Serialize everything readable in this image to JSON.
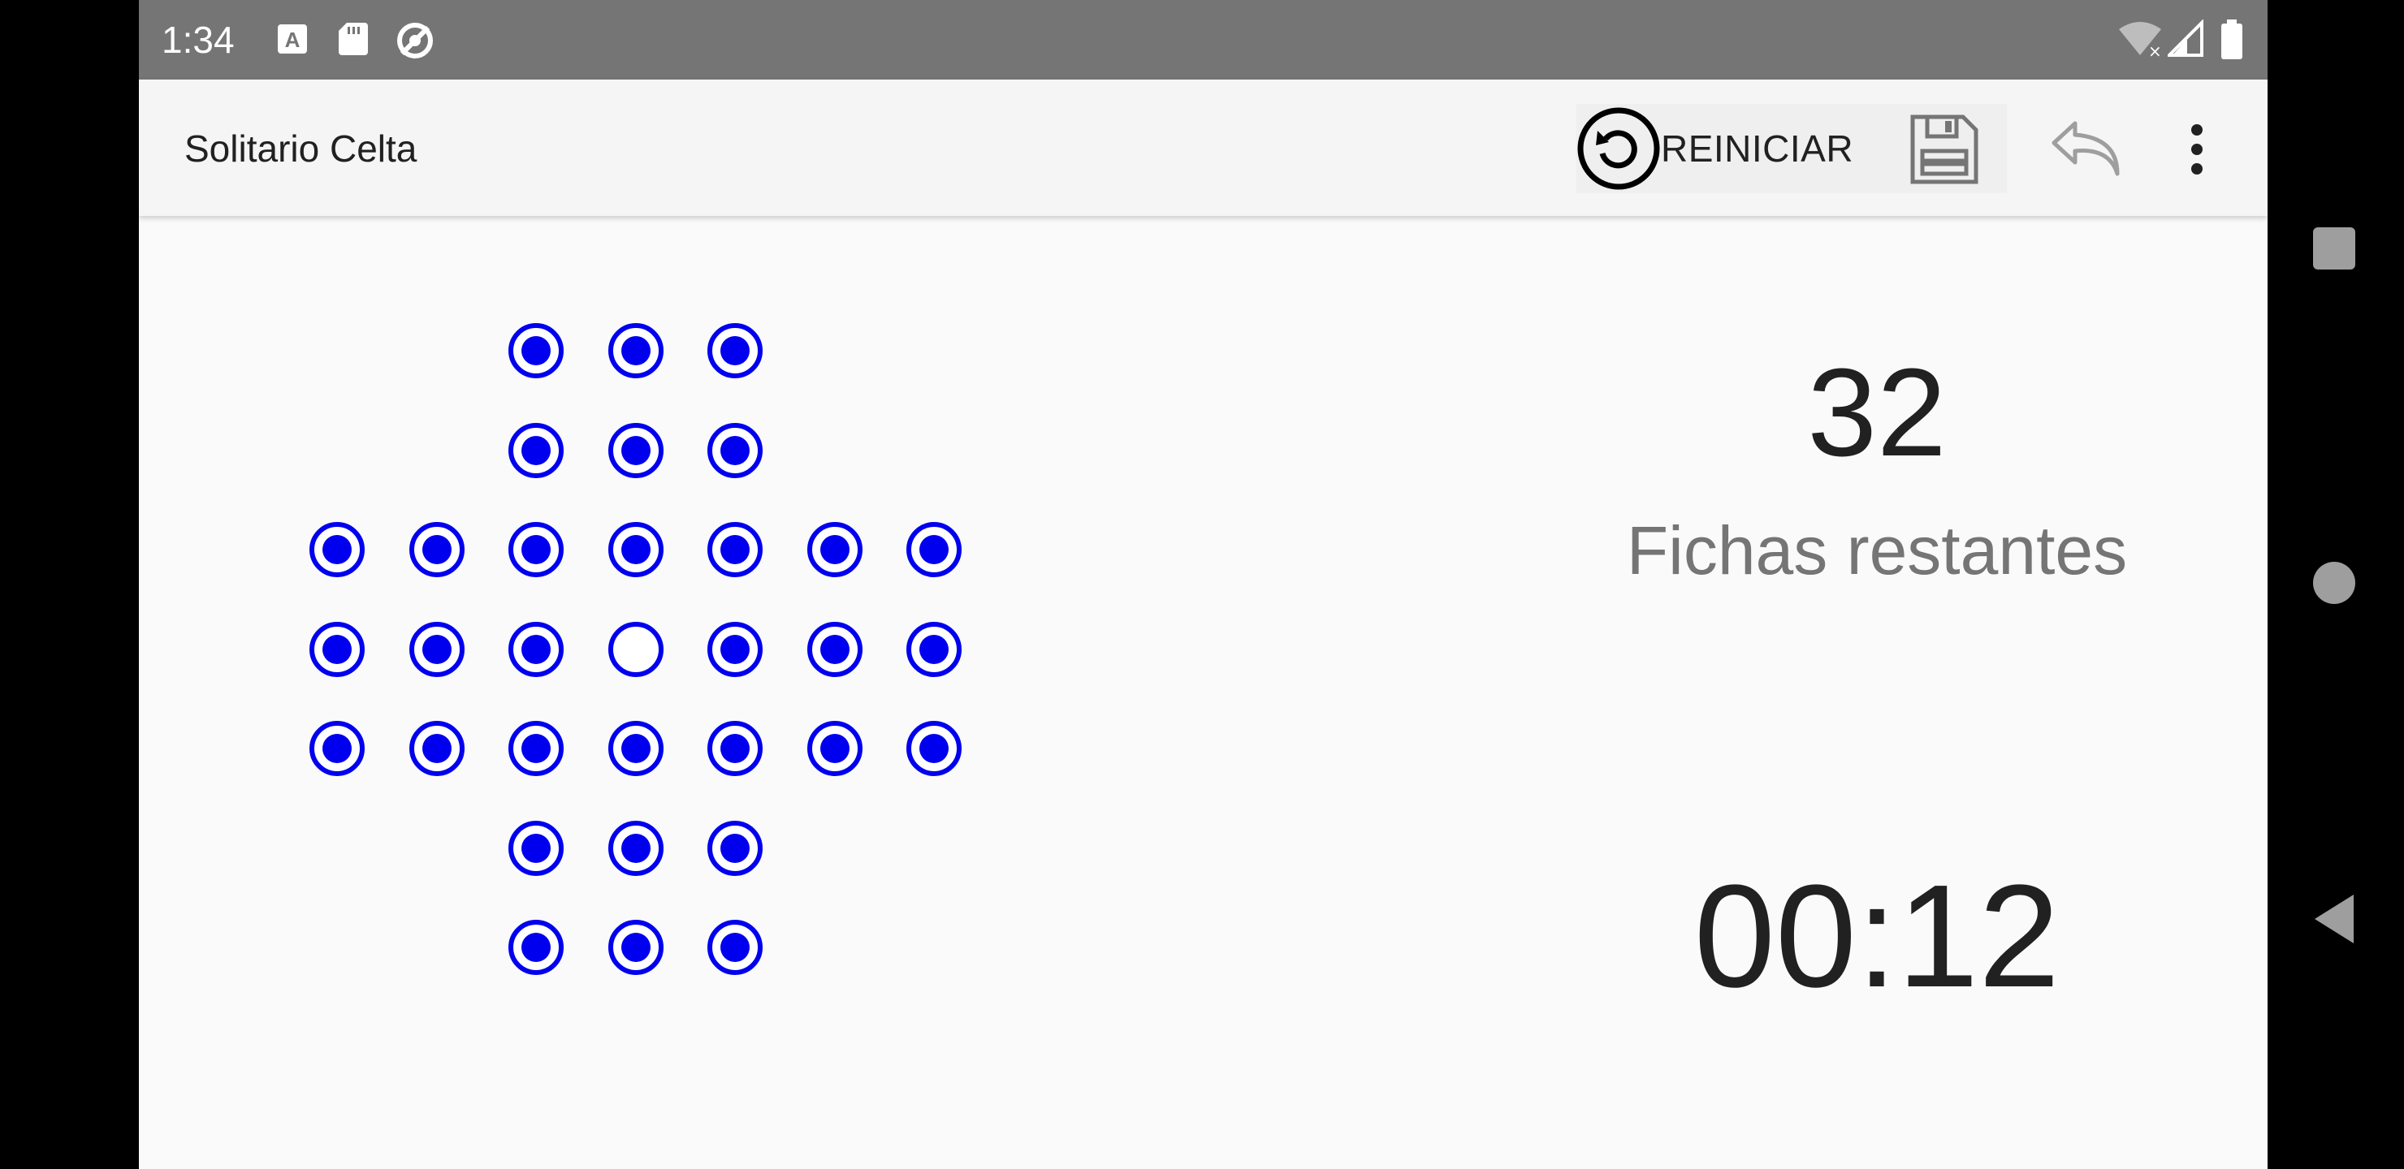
{
  "status_bar": {
    "time": "1:34",
    "icons_left": [
      "keyboard-a-icon",
      "sd-card-icon",
      "no-sync-icon"
    ],
    "icons_right": [
      "wifi-off-icon",
      "signal-icon",
      "battery-icon"
    ]
  },
  "app_bar": {
    "title": "Solitario Celta",
    "reset_label": "REINICIAR",
    "actions": [
      "restart-icon",
      "save-icon",
      "undo-icon",
      "more-vert-icon"
    ]
  },
  "board": {
    "peg_color": "#0000ee",
    "rows": [
      "  XXX  ",
      "  XXX  ",
      "XXXXXXX",
      "XXX.XXX",
      "XXXXXXX",
      "  XXX  ",
      "  XXX  "
    ]
  },
  "stats": {
    "remaining_count": "32",
    "remaining_label": "Fichas restantes",
    "timer": "00:12"
  },
  "nav_bar": {
    "buttons": [
      "recents-icon",
      "home-icon",
      "back-icon"
    ]
  }
}
